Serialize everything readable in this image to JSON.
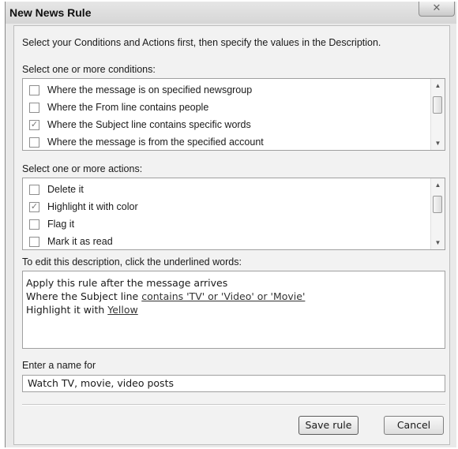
{
  "window": {
    "title": "New News Rule",
    "close_glyph": "✕"
  },
  "intro_text": "Select your Conditions and Actions first, then specify the values in the Description.",
  "conditions": {
    "label": "Select one or more conditions:",
    "items": [
      {
        "label": "Where the message is on specified newsgroup",
        "checked": false
      },
      {
        "label": "Where the From line contains people",
        "checked": false
      },
      {
        "label": "Where the Subject line contains specific words",
        "checked": true
      },
      {
        "label": "Where the message is from the specified account",
        "checked": false
      }
    ]
  },
  "actions": {
    "label": "Select one or more actions:",
    "items": [
      {
        "label": "Delete it",
        "checked": false
      },
      {
        "label": "Highlight it with color",
        "checked": true
      },
      {
        "label": "Flag it",
        "checked": false
      },
      {
        "label": "Mark it as read",
        "checked": false
      }
    ]
  },
  "description": {
    "label": "To edit this description, click the underlined words:",
    "line1": "Apply this rule after the message arrives",
    "line2_prefix": "Where the Subject line ",
    "line2_link": "contains 'TV' or 'Video' or 'Movie'",
    "line3_prefix": "Highlight it with ",
    "line3_link": "Yellow"
  },
  "name": {
    "label": "Enter a name for",
    "value": "Watch TV, movie, video posts"
  },
  "buttons": {
    "save": "Save rule",
    "cancel": "Cancel"
  },
  "glyphs": {
    "check": "✓",
    "scroll_up": "▲",
    "scroll_down": "▼"
  }
}
